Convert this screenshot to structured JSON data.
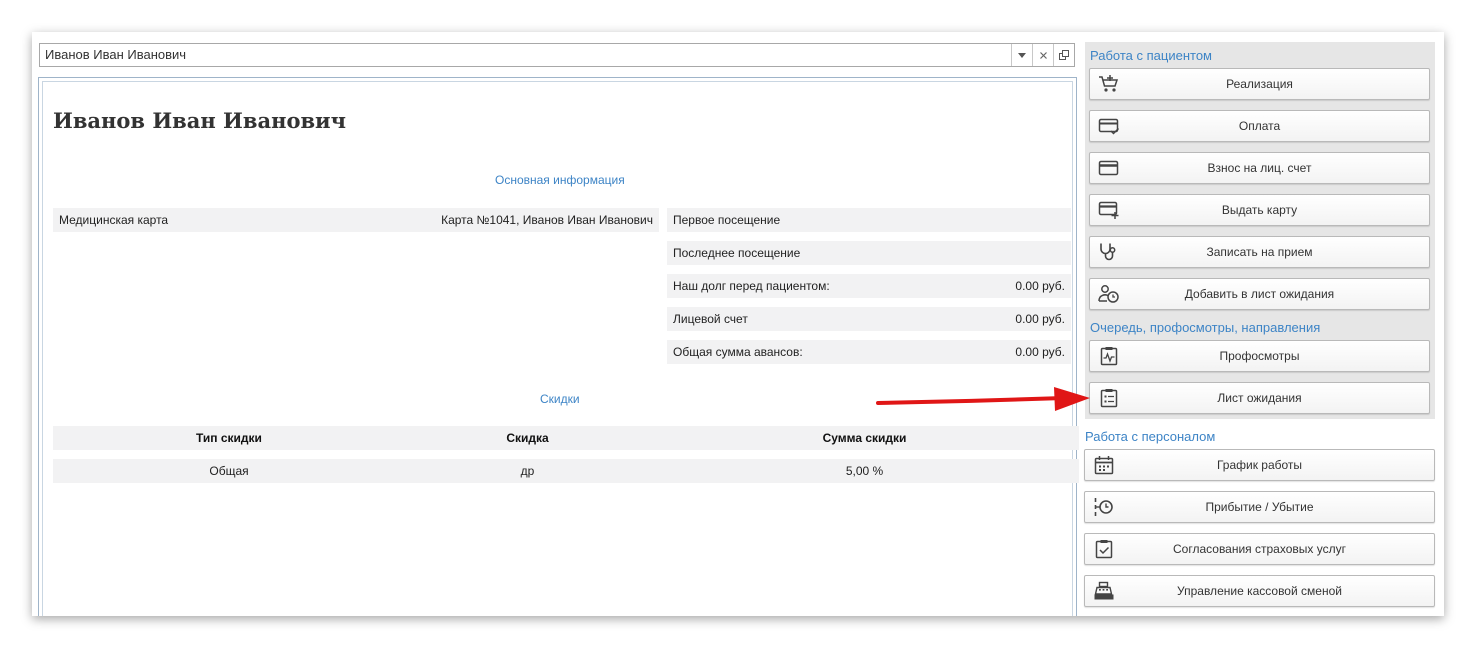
{
  "patient_field": {
    "value": "Иванов Иван Иванович"
  },
  "document": {
    "title": "Иванов Иван Иванович",
    "main_info_heading": "Основная информация",
    "left_rows": [
      {
        "label": "Медицинская карта",
        "value": "Карта №1041, Иванов Иван Иванович"
      }
    ],
    "right_rows": [
      {
        "label": "Первое посещение",
        "value": ""
      },
      {
        "label": "Последнее посещение",
        "value": ""
      },
      {
        "label": "Наш долг перед пациентом:",
        "value": "0.00 руб."
      },
      {
        "label": "Лицевой счет",
        "value": "0.00 руб."
      },
      {
        "label": "Общая сумма авансов:",
        "value": "0.00 руб."
      }
    ],
    "discounts_heading": "Скидки",
    "discounts_columns": [
      "Тип скидки",
      "Скидка",
      "Сумма скидки"
    ],
    "discounts_rows": [
      [
        "Общая",
        "др",
        "5,00 %"
      ]
    ]
  },
  "panel": {
    "group_patient": {
      "title": "Работа с пациентом",
      "buttons": [
        {
          "label": "Реализация",
          "icon": "cart-plus-icon"
        },
        {
          "label": "Оплата",
          "icon": "card-check-icon"
        },
        {
          "label": "Взнос на лиц. счет",
          "icon": "card-icon"
        },
        {
          "label": "Выдать карту",
          "icon": "card-plus-icon"
        },
        {
          "label": "Записать на прием",
          "icon": "stethoscope-icon"
        },
        {
          "label": "Добавить в лист ожидания",
          "icon": "user-clock-icon"
        }
      ]
    },
    "group_queue": {
      "title": "Очередь, профосмотры, направления",
      "buttons": [
        {
          "label": "Профосмотры",
          "icon": "clipboard-pulse-icon"
        },
        {
          "label": "Лист ожидания",
          "icon": "clipboard-list-icon"
        }
      ]
    },
    "group_staff": {
      "title": "Работа с персоналом",
      "buttons": [
        {
          "label": "График работы",
          "icon": "calendar-icon"
        },
        {
          "label": "Прибытие / Убытие",
          "icon": "clock-arrive-icon"
        },
        {
          "label": "Согласования страховых услуг",
          "icon": "clipboard-check-icon"
        },
        {
          "label": "Управление кассовой сменой",
          "icon": "cash-register-icon"
        }
      ]
    }
  },
  "colors": {
    "heading_blue": "#3d84c6",
    "arrow_red": "#e01616"
  }
}
